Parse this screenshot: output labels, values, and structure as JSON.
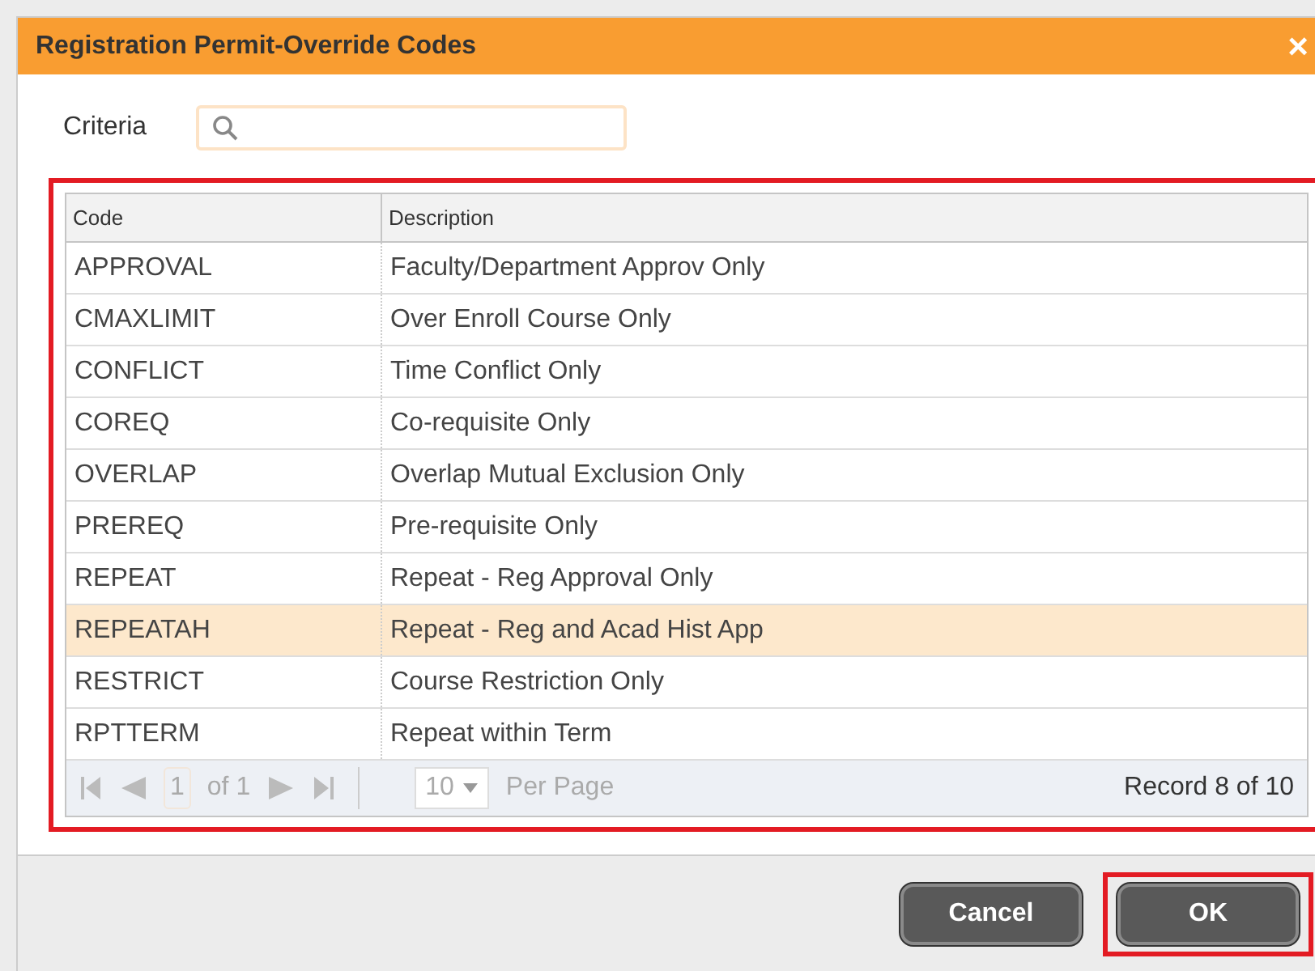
{
  "dialog": {
    "title": "Registration Permit-Override Codes",
    "close": "×"
  },
  "criteria": {
    "label": "Criteria"
  },
  "grid": {
    "highlighted": true,
    "columns": [
      "Code",
      "Description"
    ],
    "rows": [
      {
        "code": "APPROVAL",
        "description": "Faculty/Department Approv Only",
        "selected": false
      },
      {
        "code": "CMAXLIMIT",
        "description": "Over Enroll Course Only",
        "selected": false
      },
      {
        "code": "CONFLICT",
        "description": "Time Conflict Only",
        "selected": false
      },
      {
        "code": "COREQ",
        "description": "Co-requisite Only",
        "selected": false
      },
      {
        "code": "OVERLAP",
        "description": "Overlap Mutual Exclusion Only",
        "selected": false
      },
      {
        "code": "PREREQ",
        "description": "Pre-requisite Only",
        "selected": false
      },
      {
        "code": "REPEAT",
        "description": "Repeat - Reg Approval Only",
        "selected": false
      },
      {
        "code": "REPEATAH",
        "description": "Repeat - Reg and Acad Hist App",
        "selected": true
      },
      {
        "code": "RESTRICT",
        "description": "Course Restriction Only",
        "selected": false
      },
      {
        "code": "RPTTERM",
        "description": "Repeat within Term",
        "selected": false
      }
    ],
    "pager": {
      "page": "1",
      "of": "of 1",
      "page_size": "10",
      "per_page": "Per Page",
      "record": "Record 8 of 10"
    }
  },
  "buttons": [
    {
      "label": "Cancel",
      "highlighted": false
    },
    {
      "label": "OK",
      "highlighted": true
    }
  ]
}
